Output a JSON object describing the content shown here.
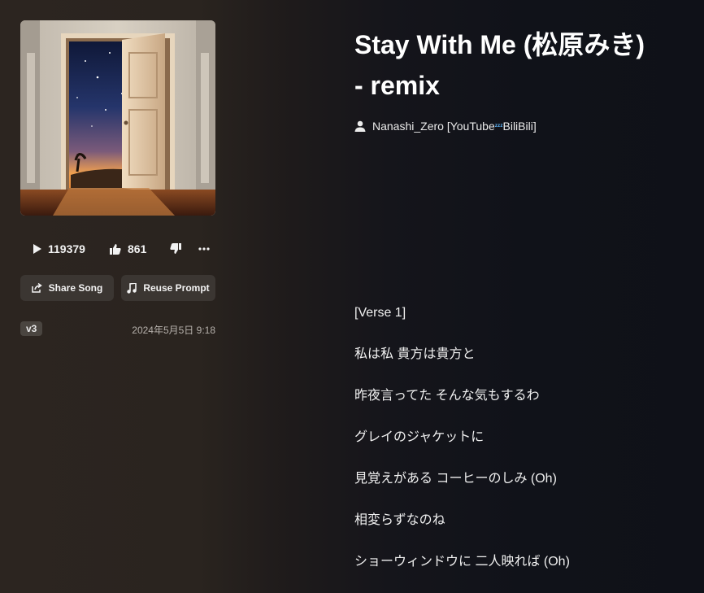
{
  "cover": {
    "alt": "Song cover art"
  },
  "stats": {
    "plays": "119379",
    "likes": "861"
  },
  "buttons": {
    "share": "Share Song",
    "reuse": "Reuse Prompt"
  },
  "meta": {
    "version": "v3",
    "date": "2024年5月5日 9:18"
  },
  "song": {
    "title_line1": "Stay With Me (松原みき)",
    "title_line2": "- remix"
  },
  "artist": {
    "name_prefix": "Nanashi_Zero [YouTube",
    "emoji": "ᶻᶻᶻ",
    "name_suffix": "BiliBili]"
  },
  "lyrics": [
    "[Verse 1]",
    "私は私 貴方は貴方と",
    "昨夜言ってた そんな気もするわ",
    "グレイのジャケットに",
    "見覚えがある コーヒーのしみ (Oh)",
    "相変らずなのね",
    "ショーウィンドウに 二人映れば (Oh)"
  ],
  "colors": {
    "button_bg": "#3b3632",
    "badge_bg": "#4a4540",
    "accent_blue": "#5fb9ff"
  }
}
